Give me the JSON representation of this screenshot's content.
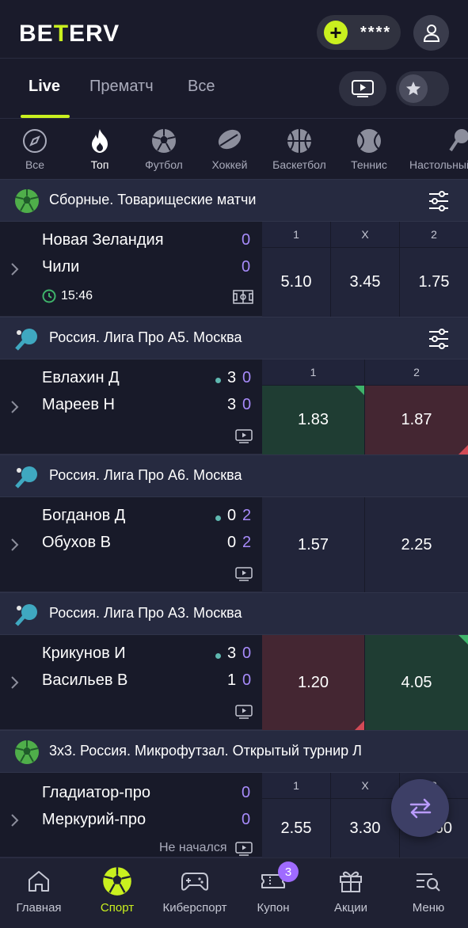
{
  "header": {
    "logo_left": "BE",
    "logo_plus": "T",
    "logo_right": "ERV",
    "balance": "****"
  },
  "tabs": [
    {
      "label": "Live"
    },
    {
      "label": "Прематч"
    },
    {
      "label": "Все"
    }
  ],
  "sports": [
    {
      "label": "Все"
    },
    {
      "label": "Топ"
    },
    {
      "label": "Футбол"
    },
    {
      "label": "Хоккей"
    },
    {
      "label": "Баскетбол"
    },
    {
      "label": "Теннис"
    },
    {
      "label": "Настольный теннис"
    }
  ],
  "leagues": [
    {
      "name": "Сборные. Товарищеские матчи"
    },
    {
      "name": "Россия. Лига Про А5. Москва"
    },
    {
      "name": "Россия. Лига Про А6. Москва"
    },
    {
      "name": "Россия. Лига Про А3. Москва"
    },
    {
      "name": "3x3. Россия. Микрофутзал. Открытый турнир Л"
    }
  ],
  "matches": [
    {
      "team1": "Новая Зеландия",
      "team2": "Чили",
      "s1": "0",
      "s2": "0",
      "time": "15:46",
      "heads": [
        "1",
        "X",
        "2"
      ],
      "odds": [
        "5.10",
        "3.45",
        "1.75"
      ]
    },
    {
      "team1": "Евлахин Д",
      "team2": "Мареев Н",
      "sets1": "3",
      "sets2": "3",
      "pts1": "0",
      "pts2": "0",
      "heads": [
        "1",
        "2"
      ],
      "odds": [
        "1.83",
        "1.87"
      ]
    },
    {
      "team1": "Богданов Д",
      "team2": "Обухов В",
      "sets1": "0",
      "sets2": "0",
      "pts1": "2",
      "pts2": "2",
      "odds": [
        "1.57",
        "2.25"
      ]
    },
    {
      "team1": "Крикунов И",
      "team2": "Васильев В",
      "sets1": "3",
      "sets2": "1",
      "pts1": "0",
      "pts2": "0",
      "odds": [
        "1.20",
        "4.05"
      ]
    },
    {
      "team1": "Гладиатор-про",
      "team2": "Меркурий-про",
      "s1": "0",
      "s2": "0",
      "status": "Не начался",
      "heads": [
        "1",
        "X",
        "2"
      ],
      "odds": [
        "2.55",
        "3.30",
        "60"
      ]
    }
  ],
  "bottom_nav": [
    {
      "label": "Главная"
    },
    {
      "label": "Спорт"
    },
    {
      "label": "Киберспорт"
    },
    {
      "label": "Купон",
      "badge": "3"
    },
    {
      "label": "Акции"
    },
    {
      "label": "Меню"
    }
  ],
  "colors": {
    "accent": "#c9f01f",
    "score": "#a78bfa",
    "odd_up": "#1f3d33",
    "odd_down": "#442632"
  }
}
